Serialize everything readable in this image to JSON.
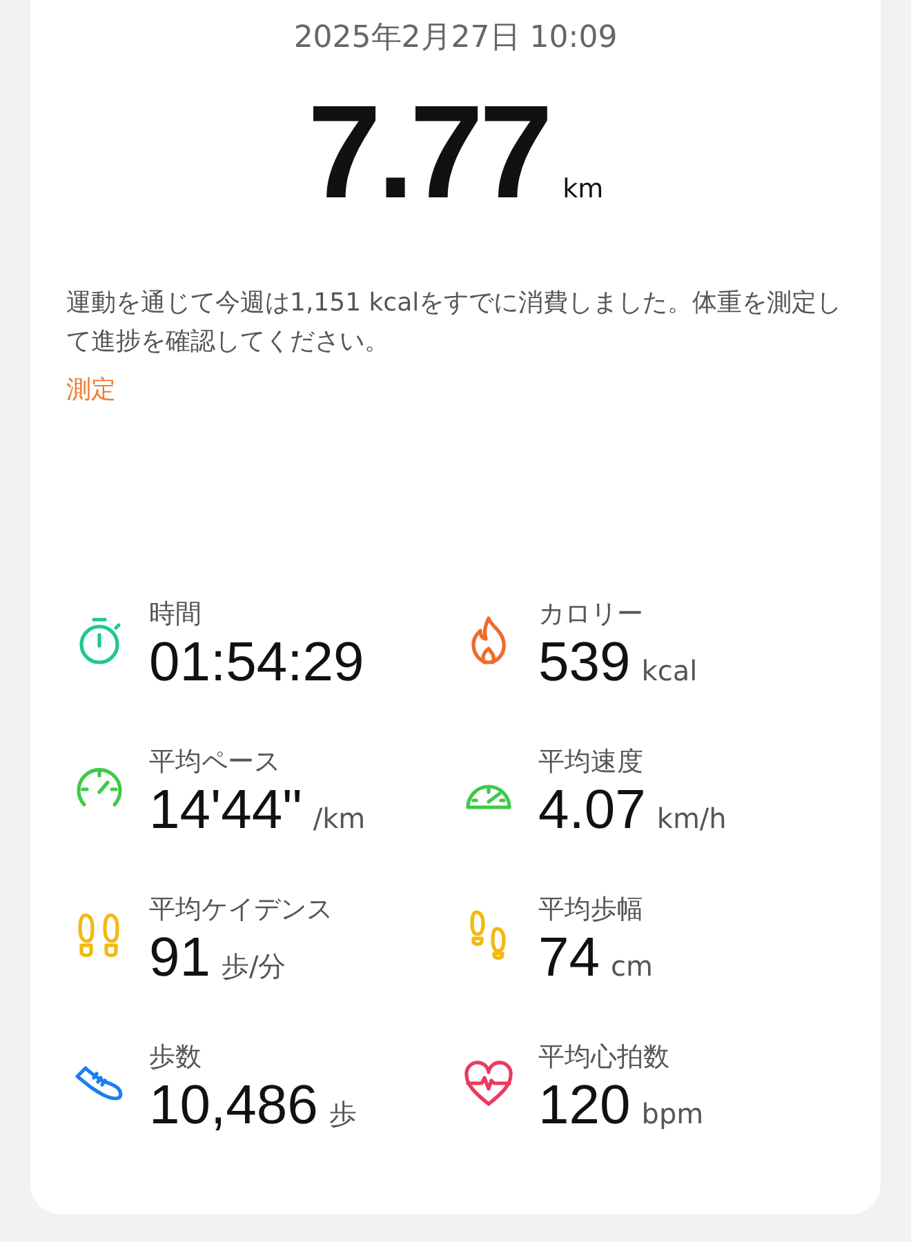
{
  "date": "2025年2月27日 10:09",
  "distance": {
    "value": "7.77",
    "unit": "km"
  },
  "message": "運動を通じて今週は1,151 kcalをすでに消費しました。体重を測定して進捗を確認してください。",
  "action_link": "測定",
  "stats": [
    {
      "kind": "stopwatch",
      "color": "#1fc98a",
      "label": "時間",
      "value": "01:54:29"
    },
    {
      "kind": "flame",
      "color": "#f06a2a",
      "label": "カロリー",
      "value": "539",
      "unit": "kcal"
    },
    {
      "kind": "pace",
      "color": "#3ec94a",
      "label": "平均ペース",
      "value": "14'44\"",
      "unit": "/km"
    },
    {
      "kind": "speed",
      "color": "#3ec94a",
      "label": "平均速度",
      "value": "4.07",
      "unit": "km/h"
    },
    {
      "kind": "feet",
      "color": "#f2b90f",
      "label": "平均ケイデンス",
      "value": "91",
      "unit": "歩/分"
    },
    {
      "kind": "steps",
      "color": "#f2b90f",
      "label": "平均歩幅",
      "value": "74",
      "unit": "cm"
    },
    {
      "kind": "shoe",
      "color": "#1a7ff0",
      "label": "歩数",
      "value": "10,486",
      "unit": "歩"
    },
    {
      "kind": "heart",
      "color": "#ec3a5e",
      "label": "平均心拍数",
      "value": "120",
      "unit": "bpm"
    }
  ]
}
